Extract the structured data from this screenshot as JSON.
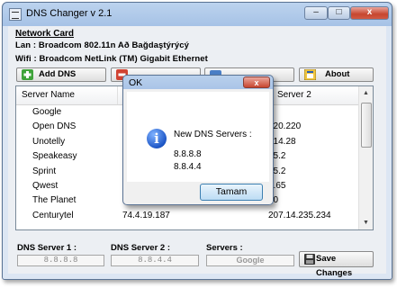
{
  "window": {
    "title": "DNS Changer v 2.1",
    "close_glyph": "x",
    "min_glyph": "–",
    "max_glyph": "□"
  },
  "network": {
    "header": "Network Card",
    "lan": "Lan : Broadcom 802.11n Að Bağdaştýrýcý",
    "wifi": "Wifi : Broadcom NetLink (TM) Gigabit Ethernet"
  },
  "toolbar": {
    "add_label": "Add DNS",
    "about_label": "About"
  },
  "list": {
    "columns": [
      "Server Name",
      "Server 2"
    ],
    "rows": [
      {
        "name": "Google",
        "dns1": "",
        "dns2": ""
      },
      {
        "name": "Open DNS",
        "dns1": "",
        "dns2": "220.220"
      },
      {
        "name": "Unotelly",
        "dns1": "",
        "dns2": "214.28"
      },
      {
        "name": "Speakeasy",
        "dns1": "",
        "dns2": "95.2"
      },
      {
        "name": "Sprint",
        "dns1": "",
        "dns2": "95.2"
      },
      {
        "name": "Qwest",
        "dns1": "",
        "dns2": "2.65"
      },
      {
        "name": "The Planet",
        "dns1": "",
        "dns2": "10"
      },
      {
        "name": "Centurytel",
        "dns1": "74.4.19.187",
        "dns2": "207.14.235.234"
      }
    ]
  },
  "footer": {
    "dns1_label": "DNS Server 1 :",
    "dns2_label": "DNS Server 2 :",
    "servers_label": "Servers :",
    "dns1_value": "8.8.8.8",
    "dns2_value": "8.8.4.4",
    "servers_value": "Google",
    "save_label": "Save Changes"
  },
  "dialog": {
    "title": "OK",
    "close_glyph": "x",
    "message_head": "New DNS Servers :",
    "dns1": "8.8.8.8",
    "dns2": "8.8.4.4",
    "ok_label": "Tamam",
    "icon_glyph": "i"
  }
}
